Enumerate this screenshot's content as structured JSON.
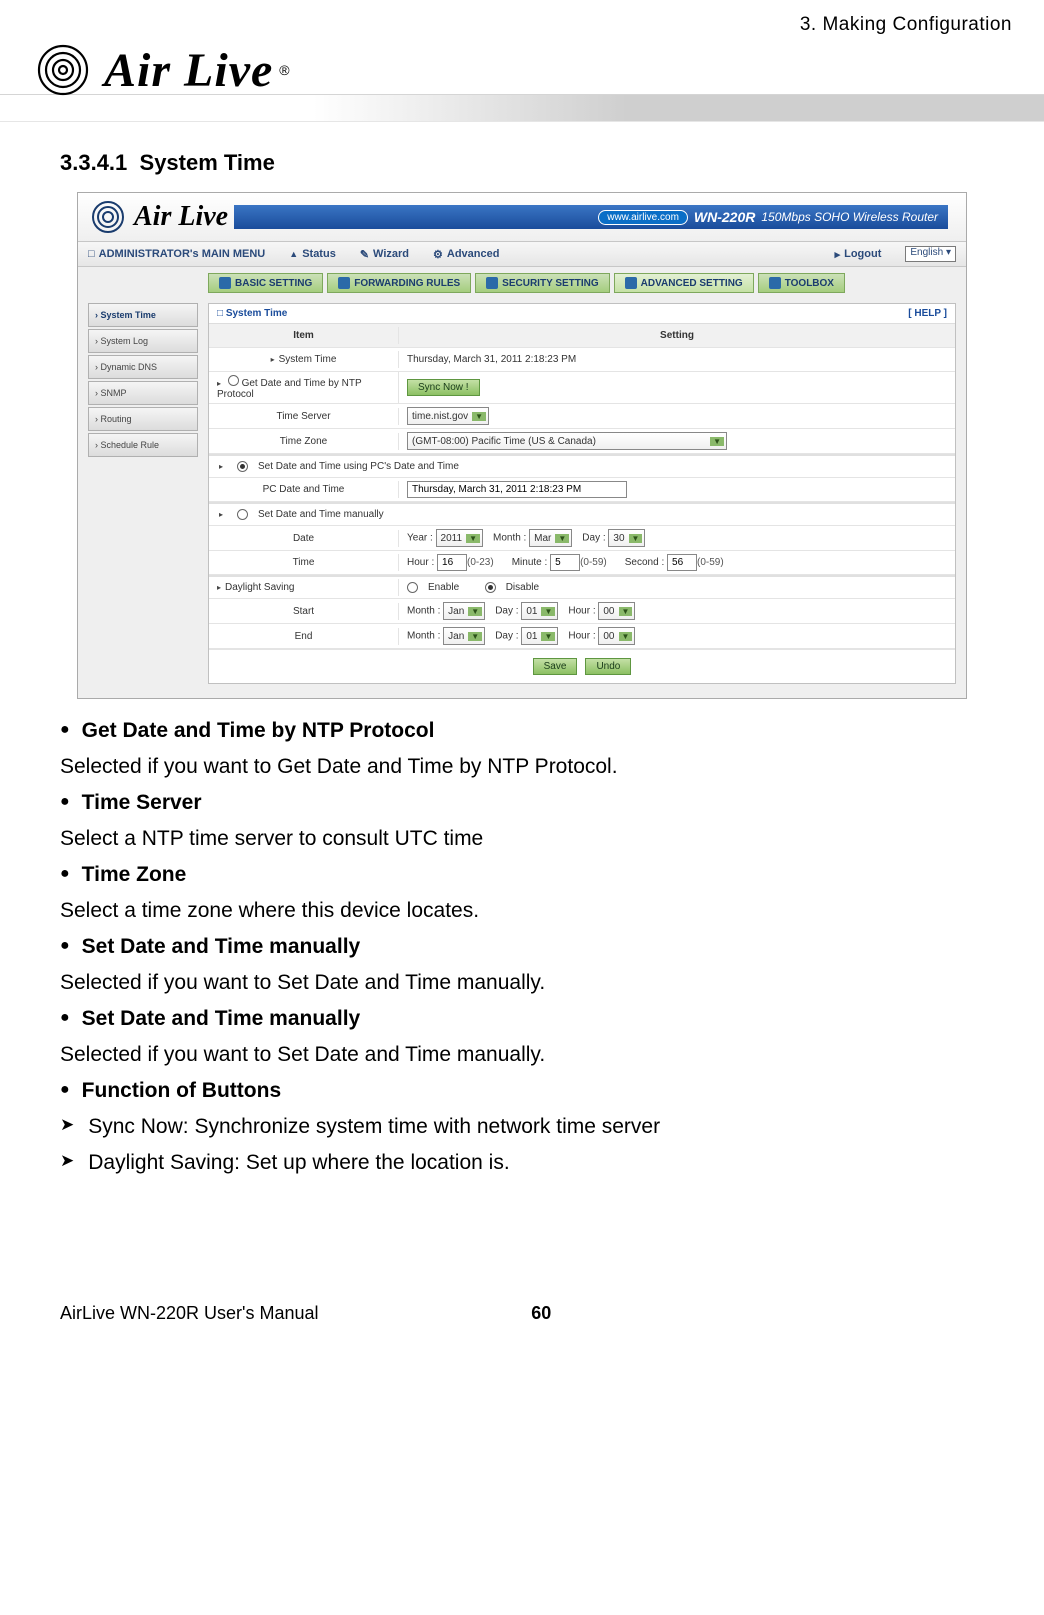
{
  "page": {
    "chapter": "3. Making Configuration",
    "logo_text": "Air Live",
    "section_number": "3.3.4.1",
    "section_title": "System Time",
    "footer_left": "AirLive WN-220R User's Manual",
    "footer_page": "60"
  },
  "screenshot": {
    "logo": "Air Live",
    "url_pill": "www.airlive.com",
    "model": "WN-220R",
    "model_desc": "150Mbps SOHO Wireless Router",
    "nav": {
      "admin_menu": "ADMINISTRATOR's MAIN MENU",
      "status": "Status",
      "wizard": "Wizard",
      "advanced": "Advanced",
      "logout": "Logout",
      "language": "English"
    },
    "tabs": {
      "basic": "BASIC SETTING",
      "forwarding": "FORWARDING RULES",
      "security": "SECURITY SETTING",
      "advanced": "ADVANCED SETTING",
      "toolbox": "TOOLBOX"
    },
    "sidebar": {
      "items": [
        "System Time",
        "System Log",
        "Dynamic DNS",
        "SNMP",
        "Routing",
        "Schedule Rule"
      ]
    },
    "panel": {
      "title": "System Time",
      "help": "[ HELP ]",
      "header_item": "Item",
      "header_setting": "Setting",
      "system_time_label": "System Time",
      "system_time_value": "Thursday, March 31, 2011 2:18:23 PM",
      "ntp_label": "Get Date and Time by NTP Protocol",
      "sync_btn": "Sync Now !",
      "time_server_label": "Time Server",
      "time_server_value": "time.nist.gov",
      "time_zone_label": "Time Zone",
      "time_zone_value": "(GMT-08:00) Pacific Time (US & Canada)",
      "pc_label": "Set Date and Time using PC's Date and Time",
      "pc_sub_label": "PC Date and Time",
      "pc_value": "Thursday, March 31, 2011 2:18:23 PM",
      "manual_label": "Set Date and Time manually",
      "date_label": "Date",
      "year_label": "Year :",
      "year_value": "2011",
      "month_label": "Month :",
      "month_value": "Mar",
      "day_label": "Day :",
      "day_value": "30",
      "time_label": "Time",
      "hour_label": "Hour :",
      "hour_value": "16",
      "hour_range": "(0-23)",
      "minute_label": "Minute :",
      "minute_value": "5",
      "minute_range": "(0-59)",
      "second_label": "Second :",
      "second_value": "56",
      "second_range": "(0-59)",
      "daylight_label": "Daylight Saving",
      "enable": "Enable",
      "disable": "Disable",
      "start_label": "Start",
      "end_label": "End",
      "dl_month_label": "Month :",
      "dl_month_value": "Jan",
      "dl_day_label": "Day :",
      "dl_day_value": "01",
      "dl_hour_label": "Hour :",
      "dl_hour_value": "00",
      "save": "Save",
      "undo": "Undo"
    }
  },
  "bullets": [
    {
      "title": "Get Date and Time by NTP Protocol",
      "desc": "Selected if you want to Get Date and Time by NTP Protocol."
    },
    {
      "title": "Time Server",
      "desc": "Select a NTP time server to consult UTC time"
    },
    {
      "title": "Time Zone",
      "desc": "Select a time zone where this device locates."
    },
    {
      "title": "Set Date and Time manually",
      "desc": "Selected if you want to Set Date and Time manually."
    },
    {
      "title": "Set Date and Time manually",
      "desc": "Selected if you want to Set Date and Time manually."
    },
    {
      "title": "Function of Buttons",
      "desc": ""
    }
  ],
  "sub_bullets": [
    "Sync Now: Synchronize system time with network time server",
    "Daylight Saving: Set up where the location is."
  ]
}
